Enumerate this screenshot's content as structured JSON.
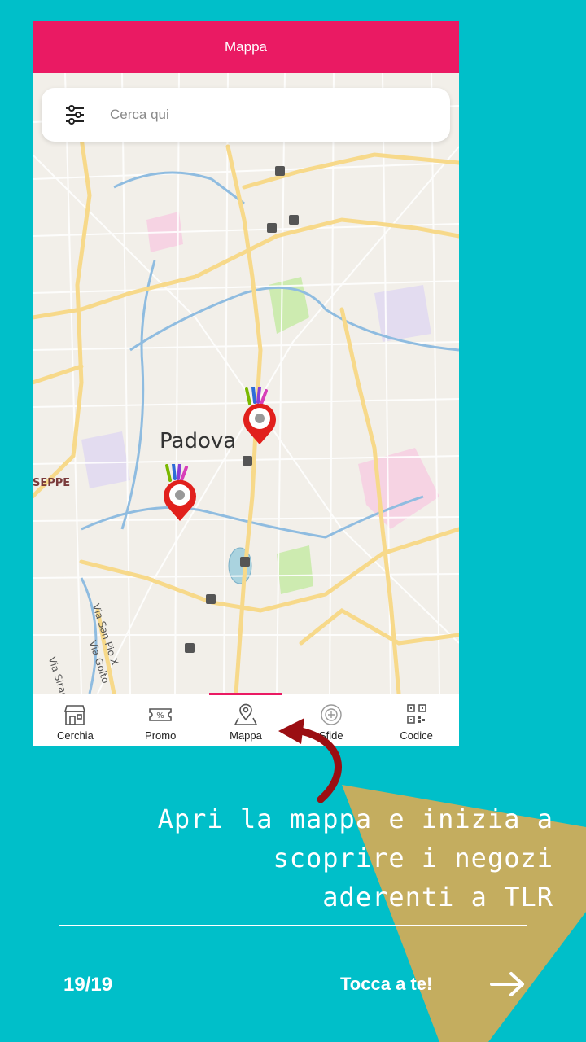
{
  "colors": {
    "background": "#00BFC9",
    "gold": "#C4AD5F",
    "appbar": "#EA1A63",
    "tab_indicator": "#EA1A63",
    "pin": "#E1201C"
  },
  "app": {
    "title": "Mappa",
    "search": {
      "placeholder": "Cerca qui",
      "value": ""
    }
  },
  "map": {
    "city_label": "Padova",
    "district_label": "SEPPE",
    "street_labels": [
      "Via San Pio X",
      "Via Goito",
      "Via Siracu"
    ]
  },
  "tabs": [
    {
      "label": "Cerchia",
      "icon": "shop-icon",
      "active": false
    },
    {
      "label": "Promo",
      "icon": "ticket-percent-icon",
      "active": false
    },
    {
      "label": "Mappa",
      "icon": "map-pin-icon",
      "active": true
    },
    {
      "label": "Sfide",
      "icon": "challenge-icon",
      "active": false
    },
    {
      "label": "Codice",
      "icon": "qr-code-icon",
      "active": false
    }
  ],
  "slide": {
    "caption_lines": [
      "Apri la mappa e inizia a",
      "scoprire i negozi",
      "aderenti a TLR"
    ],
    "page_number": "19/19",
    "cta": "Tocca a te!"
  }
}
